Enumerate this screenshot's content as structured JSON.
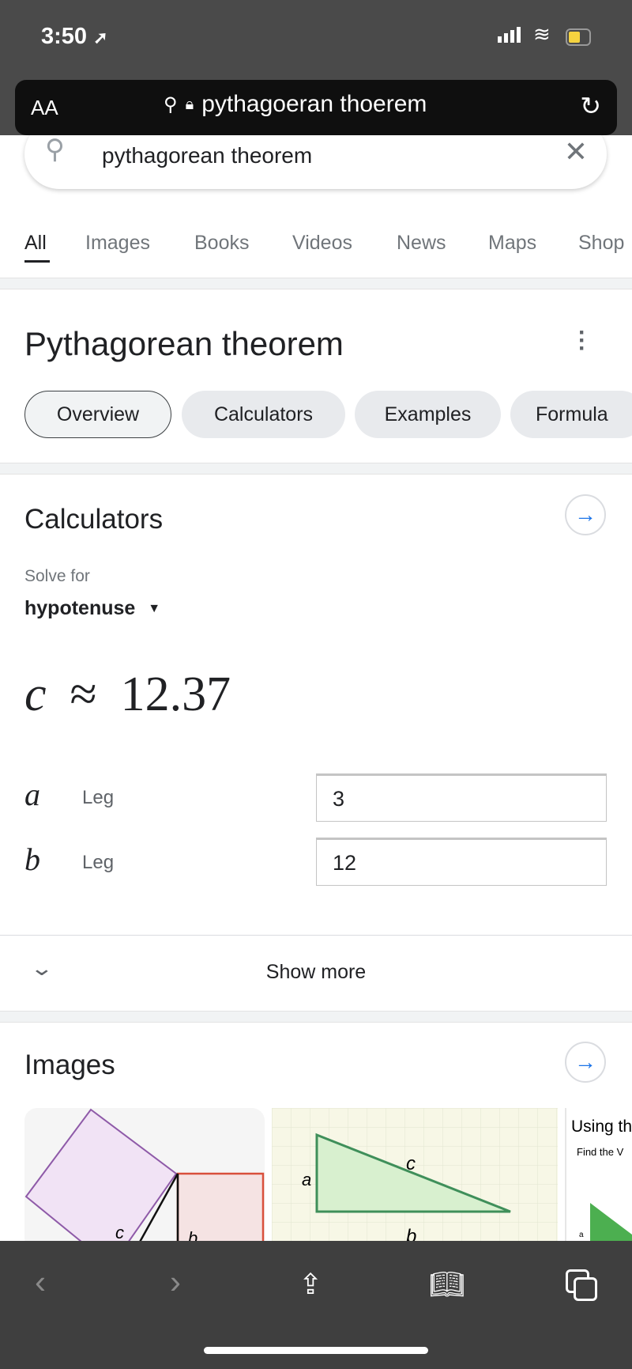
{
  "status": {
    "time": "3:50",
    "location_icon": "location-arrow-icon",
    "battery_color": "#f5d33f"
  },
  "url_bar": {
    "text_size": "AA",
    "url": "pythagoeran thoerem"
  },
  "search": {
    "value": "pythagorean theorem"
  },
  "tabs": [
    {
      "label": "All",
      "active": true
    },
    {
      "label": "Images"
    },
    {
      "label": "Books"
    },
    {
      "label": "Videos"
    },
    {
      "label": "News"
    },
    {
      "label": "Maps"
    },
    {
      "label": "Shop"
    }
  ],
  "header": {
    "title": "Pythagorean theorem"
  },
  "chips": [
    {
      "label": "Overview",
      "selected": true
    },
    {
      "label": "Calculators"
    },
    {
      "label": "Examples"
    },
    {
      "label": "Formula"
    }
  ],
  "calculator": {
    "heading": "Calculators",
    "solve_for_label": "Solve for",
    "solve_for_value": "hypotenuse",
    "result_var": "c",
    "approx": "≈",
    "result": "12.37",
    "inputs": [
      {
        "var": "a",
        "label": "Leg",
        "value": "3"
      },
      {
        "var": "b",
        "label": "Leg",
        "value": "12"
      }
    ],
    "show_more": "Show more"
  },
  "images": {
    "heading": "Images",
    "thumb1": {
      "labels": [
        "c",
        "b"
      ]
    },
    "thumb2": {
      "labels": [
        "a",
        "c",
        "b"
      ]
    },
    "thumb3": {
      "title": "Using th",
      "subtitle": "Find the V",
      "label": "a"
    }
  },
  "accent": "#1a73e8"
}
